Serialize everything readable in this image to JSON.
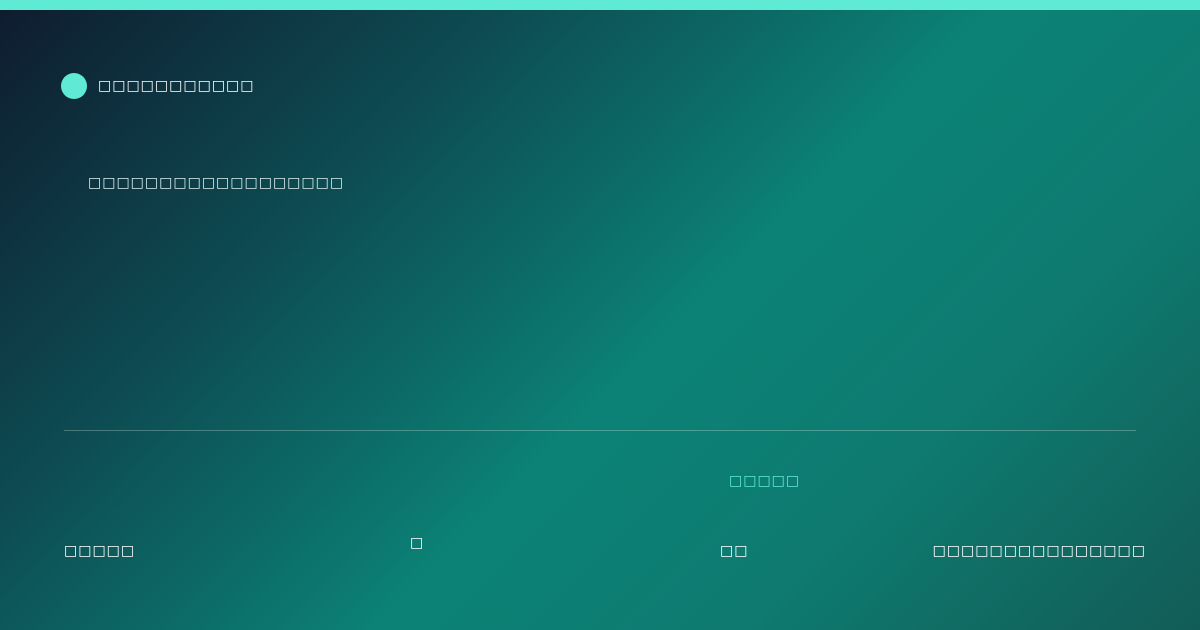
{
  "brand": {
    "name": "□□□□□□□□□□□",
    "accent": "#5eead4"
  },
  "subtitle": "□□□□□□□□□□□□□□□□□□",
  "footer": {
    "left_label": "□□□□□",
    "center_glyph": "□",
    "highlight_label": "□□□□□",
    "small_label": "□□",
    "right_label": "□□□□□□□□□□□□□□□"
  }
}
